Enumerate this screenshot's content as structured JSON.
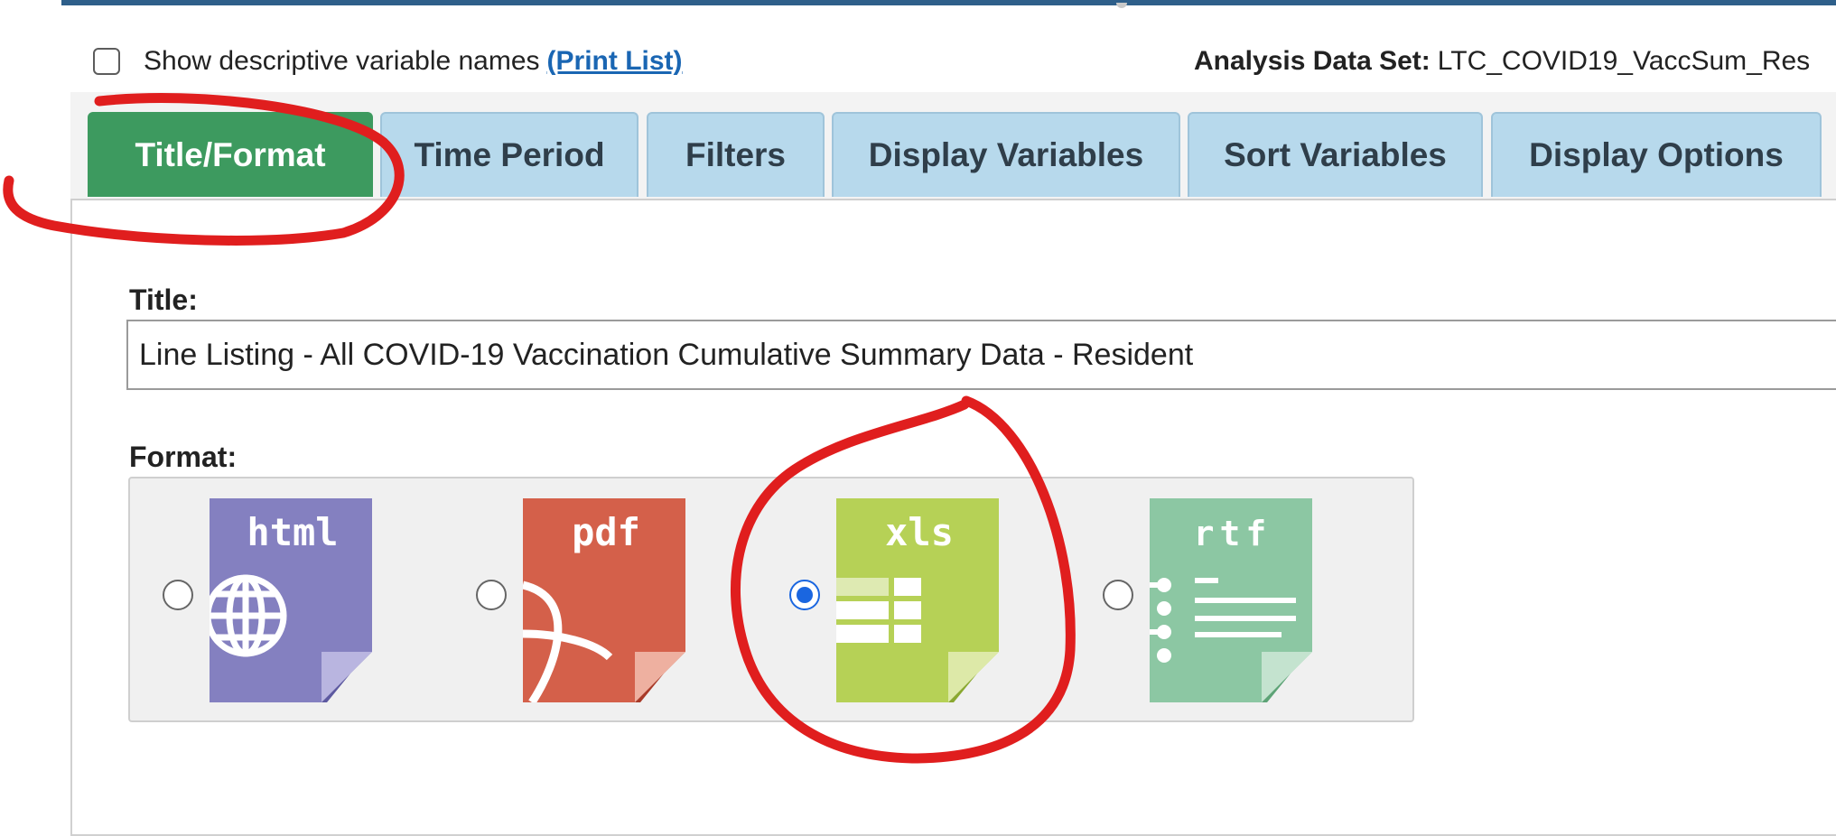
{
  "header": {
    "show_descriptive_label": "Show descriptive variable names",
    "print_list_link": "(Print List)",
    "dataset_label": "Analysis Data Set:",
    "dataset_value": "LTC_COVID19_VaccSum_Res"
  },
  "tabs": [
    {
      "label": "Title/Format",
      "active": true
    },
    {
      "label": "Time Period",
      "active": false
    },
    {
      "label": "Filters",
      "active": false
    },
    {
      "label": "Display Variables",
      "active": false
    },
    {
      "label": "Sort Variables",
      "active": false
    },
    {
      "label": "Display Options",
      "active": false
    }
  ],
  "title_section": {
    "label": "Title:",
    "value": "Line Listing - All COVID-19 Vaccination Cumulative Summary Data - Resident"
  },
  "format_section": {
    "label": "Format:",
    "options": [
      {
        "text": "html",
        "color": "#8480c0",
        "selected": false
      },
      {
        "text": "pdf",
        "color": "#d4604a",
        "selected": false
      },
      {
        "text": "xls",
        "color": "#b6d156",
        "selected": true
      },
      {
        "text": "rtf",
        "color": "#8cc7a3",
        "selected": false
      }
    ]
  },
  "colors": {
    "active_tab": "#3d9a5f",
    "inactive_tab": "#b7d9ec",
    "annotation": "#e01e1e",
    "radio_selected": "#1a66e0"
  }
}
